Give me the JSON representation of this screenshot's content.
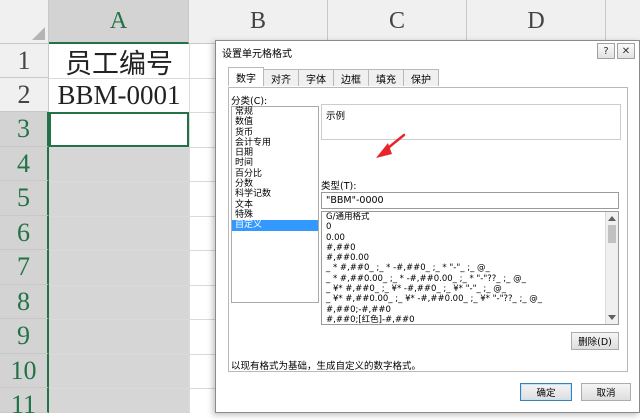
{
  "sheet": {
    "columns": [
      "A",
      "B",
      "C",
      "D"
    ],
    "rows": [
      "1",
      "2",
      "3",
      "4",
      "5",
      "6",
      "7",
      "8",
      "9",
      "10",
      "11"
    ],
    "cells": {
      "A1": "员工编号",
      "A2": "BBM-0001"
    }
  },
  "dialog": {
    "title": "设置单元格格式",
    "help_icon": "?",
    "close_icon": "✕",
    "tabs": [
      {
        "label": "数字",
        "active": true
      },
      {
        "label": "对齐"
      },
      {
        "label": "字体"
      },
      {
        "label": "边框"
      },
      {
        "label": "填充"
      },
      {
        "label": "保护"
      }
    ],
    "category_label": "分类(C):",
    "categories": [
      "常规",
      "数值",
      "货币",
      "会计专用",
      "日期",
      "时间",
      "百分比",
      "分数",
      "科学记数",
      "文本",
      "特殊",
      "自定义"
    ],
    "selected_category": "自定义",
    "sample_label": "示例",
    "type_label": "类型(T):",
    "type_value": "\"BBM\"-0000",
    "formats": [
      "G/通用格式",
      "0",
      "0.00",
      "#,##0",
      "#,##0.00",
      "_ * #,##0_ ;_ * -#,##0_ ;_ * \"-\"_ ;_ @_",
      "_ * #,##0.00_ ;_ * -#,##0.00_ ;_ * \"-\"??_ ;_ @_",
      "_ ¥* #,##0_ ;_ ¥* -#,##0_ ;_ ¥* \"-\"_ ;_ @_",
      "_ ¥* #,##0.00_ ;_ ¥* -#,##0.00_ ;_ ¥* \"-\"??_ ;_ @_",
      "#,##0;-#,##0",
      "#,##0;[红色]-#,##0"
    ],
    "delete_label": "删除(D)",
    "hint": "以现有格式为基础，生成自定义的数字格式。",
    "ok_label": "确定",
    "cancel_label": "取消"
  },
  "colors": {
    "accent": "#217346",
    "selection": "#3399ff",
    "annotation_arrow": "#e8262a"
  }
}
